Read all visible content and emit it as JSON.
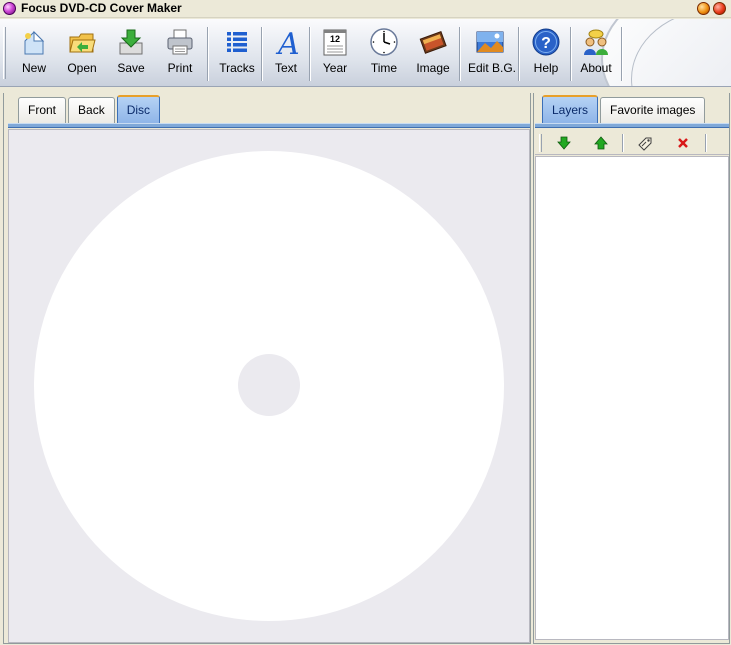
{
  "window": {
    "title": "Focus DVD-CD Cover Maker",
    "icon": "app-disc-icon",
    "controls": [
      "minimize-icon",
      "close-icon"
    ]
  },
  "toolbar": {
    "buttons": [
      {
        "label": "New",
        "icon": "new-document-icon"
      },
      {
        "label": "Open",
        "icon": "open-folder-icon"
      },
      {
        "label": "Save",
        "icon": "save-icon"
      },
      {
        "label": "Print",
        "icon": "printer-icon"
      },
      {
        "label": "Tracks",
        "icon": "tracks-list-icon"
      },
      {
        "label": "Text",
        "icon": "text-icon"
      },
      {
        "label": "Year",
        "icon": "calendar-icon",
        "badge": "12"
      },
      {
        "label": "Time",
        "icon": "clock-icon"
      },
      {
        "label": "Image",
        "icon": "image-icon"
      },
      {
        "label": "Edit B.G.",
        "icon": "background-icon"
      },
      {
        "label": "Help",
        "icon": "help-icon"
      },
      {
        "label": "About",
        "icon": "about-icon"
      }
    ]
  },
  "left_panel": {
    "tabs": [
      {
        "label": "Front",
        "active": false
      },
      {
        "label": "Back",
        "active": false
      },
      {
        "label": "Disc",
        "active": true
      }
    ]
  },
  "right_panel": {
    "tabs": [
      {
        "label": "Layers",
        "active": true
      },
      {
        "label": "Favorite images",
        "active": false
      }
    ],
    "layer_tools": [
      {
        "name": "move-down",
        "icon": "arrow-down-icon",
        "color": "#22a822"
      },
      {
        "name": "move-up",
        "icon": "arrow-up-icon",
        "color": "#22a822"
      },
      {
        "name": "edit-layer",
        "icon": "edit-tag-icon"
      },
      {
        "name": "delete-layer",
        "icon": "delete-icon",
        "color": "#d81818"
      }
    ]
  },
  "colors": {
    "active_tab": "#8fb5e8",
    "panel_bar": "#7fa8d8",
    "canvas_bg": "#ebeaef",
    "disc": "#ffffff"
  }
}
